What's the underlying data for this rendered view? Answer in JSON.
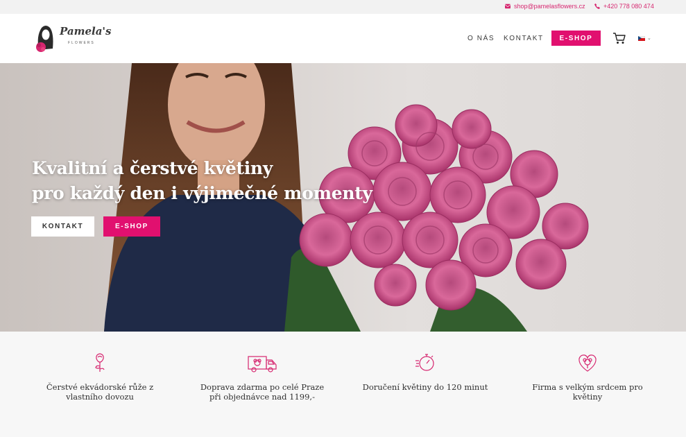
{
  "topbar": {
    "email": "shop@pamelasflowers.cz",
    "phone": "+420 778 080 474",
    "email_icon": "envelope-icon",
    "phone_icon": "phone-icon"
  },
  "header": {
    "logo_script": "Pamela's",
    "logo_sub": "FLOWERS",
    "nav": [
      {
        "label": "O NÁS"
      },
      {
        "label": "KONTAKT"
      }
    ],
    "eshop_label": "E-SHOP",
    "cart_icon": "cart-icon",
    "language_flag": "czech-flag-icon"
  },
  "hero": {
    "title_line1": "Kvalitní a čerstvé květiny",
    "title_line2": "pro každý den i výjimečné momenty",
    "btn_kontakt": "KONTAKT",
    "btn_eshop": "E-SHOP"
  },
  "features": [
    {
      "icon": "rose-icon",
      "text": "Čerstvé ekvádorské růže z vlastního dovozu"
    },
    {
      "icon": "delivery-van-icon",
      "text": "Doprava zdarma po celé Praze při objednávce nad 1199,-"
    },
    {
      "icon": "stopwatch-icon",
      "text": "Doručení květiny do 120 minut"
    },
    {
      "icon": "heart-flower-icon",
      "text": "Firma s velkým srdcem pro květiny"
    }
  ],
  "colors": {
    "accent": "#e1106f",
    "topbar_bg": "#f2f2f2",
    "header_bg": "#ffffff",
    "text_dark": "#2f2f2f"
  }
}
